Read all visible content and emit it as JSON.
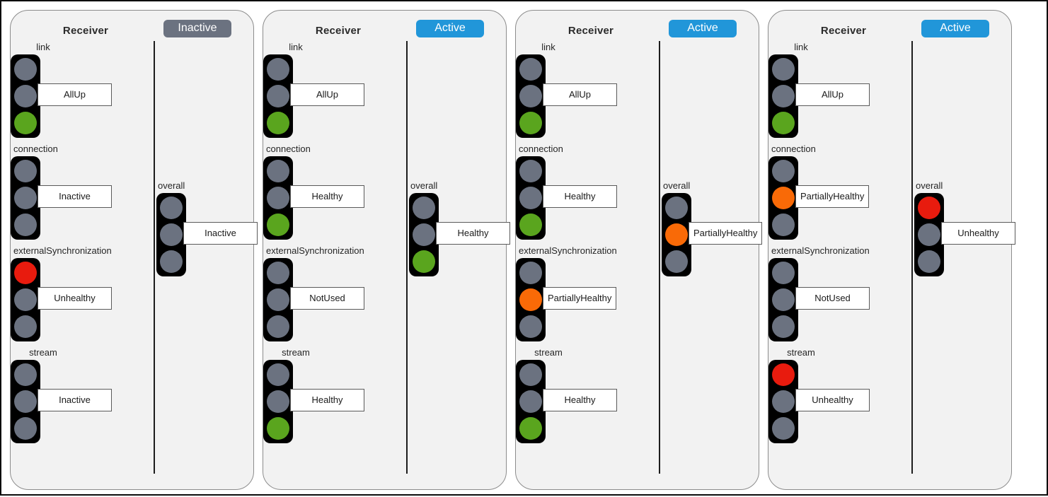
{
  "colors": {
    "green": "#5aa51e",
    "red": "#e81b0e",
    "orange": "#f96a07",
    "gray_lamp": "#6b7280",
    "badge_active": "#2196d9",
    "badge_inactive": "#6b7280",
    "panel_bg": "#f2f2f2",
    "panel_border": "#8c8c8c",
    "housing": "#000000",
    "canvas_border": "#0d0d0d"
  },
  "panels": [
    {
      "title": "Receiver",
      "status": {
        "label": "Inactive",
        "color": "#6b7280"
      },
      "signals": [
        {
          "name": "link",
          "value": "AllUp",
          "lit": "bottom",
          "color": "#5aa51e",
          "box": "narrow",
          "label_align": "center"
        },
        {
          "name": "connection",
          "value": "Inactive",
          "lit": "none",
          "color": "#6b7280",
          "box": "narrow",
          "label_align": "left"
        },
        {
          "name": "externalSynchronization",
          "value": "Unhealthy",
          "lit": "top",
          "color": "#e81b0e",
          "box": "narrow",
          "label_align": "left"
        },
        {
          "name": "stream",
          "value": "Inactive",
          "lit": "none",
          "color": "#6b7280",
          "box": "narrow",
          "label_align": "center"
        }
      ],
      "overall": {
        "name": "overall",
        "value": "Inactive",
        "lit": "none",
        "color": "#6b7280",
        "box": "narrow"
      }
    },
    {
      "title": "Receiver",
      "status": {
        "label": "Active",
        "color": "#2196d9"
      },
      "signals": [
        {
          "name": "link",
          "value": "AllUp",
          "lit": "bottom",
          "color": "#5aa51e",
          "box": "narrow",
          "label_align": "center"
        },
        {
          "name": "connection",
          "value": "Healthy",
          "lit": "bottom",
          "color": "#5aa51e",
          "box": "narrow",
          "label_align": "left"
        },
        {
          "name": "externalSynchronization",
          "value": "NotUsed",
          "lit": "none",
          "color": "#6b7280",
          "box": "narrow",
          "label_align": "left"
        },
        {
          "name": "stream",
          "value": "Healthy",
          "lit": "bottom",
          "color": "#5aa51e",
          "box": "narrow",
          "label_align": "center"
        }
      ],
      "overall": {
        "name": "overall",
        "value": "Healthy",
        "lit": "bottom",
        "color": "#5aa51e",
        "box": "narrow"
      }
    },
    {
      "title": "Receiver",
      "status": {
        "label": "Active",
        "color": "#2196d9"
      },
      "signals": [
        {
          "name": "link",
          "value": "AllUp",
          "lit": "bottom",
          "color": "#5aa51e",
          "box": "narrow",
          "label_align": "center"
        },
        {
          "name": "connection",
          "value": "Healthy",
          "lit": "bottom",
          "color": "#5aa51e",
          "box": "narrow",
          "label_align": "left"
        },
        {
          "name": "externalSynchronization",
          "value": "PartiallyHealthy",
          "lit": "middle",
          "color": "#f96a07",
          "box": "fit",
          "label_align": "left"
        },
        {
          "name": "stream",
          "value": "Healthy",
          "lit": "bottom",
          "color": "#5aa51e",
          "box": "narrow",
          "label_align": "center"
        }
      ],
      "overall": {
        "name": "overall",
        "value": "PartiallyHealthy",
        "lit": "middle",
        "color": "#f96a07",
        "box": "fit"
      }
    },
    {
      "title": "Receiver",
      "status": {
        "label": "Active",
        "color": "#2196d9"
      },
      "signals": [
        {
          "name": "link",
          "value": "AllUp",
          "lit": "bottom",
          "color": "#5aa51e",
          "box": "narrow",
          "label_align": "center"
        },
        {
          "name": "connection",
          "value": "PartiallyHealthy",
          "lit": "middle",
          "color": "#f96a07",
          "box": "fit",
          "label_align": "left"
        },
        {
          "name": "externalSynchronization",
          "value": "NotUsed",
          "lit": "none",
          "color": "#6b7280",
          "box": "narrow",
          "label_align": "left"
        },
        {
          "name": "stream",
          "value": "Unhealthy",
          "lit": "top",
          "color": "#e81b0e",
          "box": "narrow",
          "label_align": "center"
        }
      ],
      "overall": {
        "name": "overall",
        "value": "Unhealthy",
        "lit": "top",
        "color": "#e81b0e",
        "box": "narrow"
      }
    }
  ]
}
